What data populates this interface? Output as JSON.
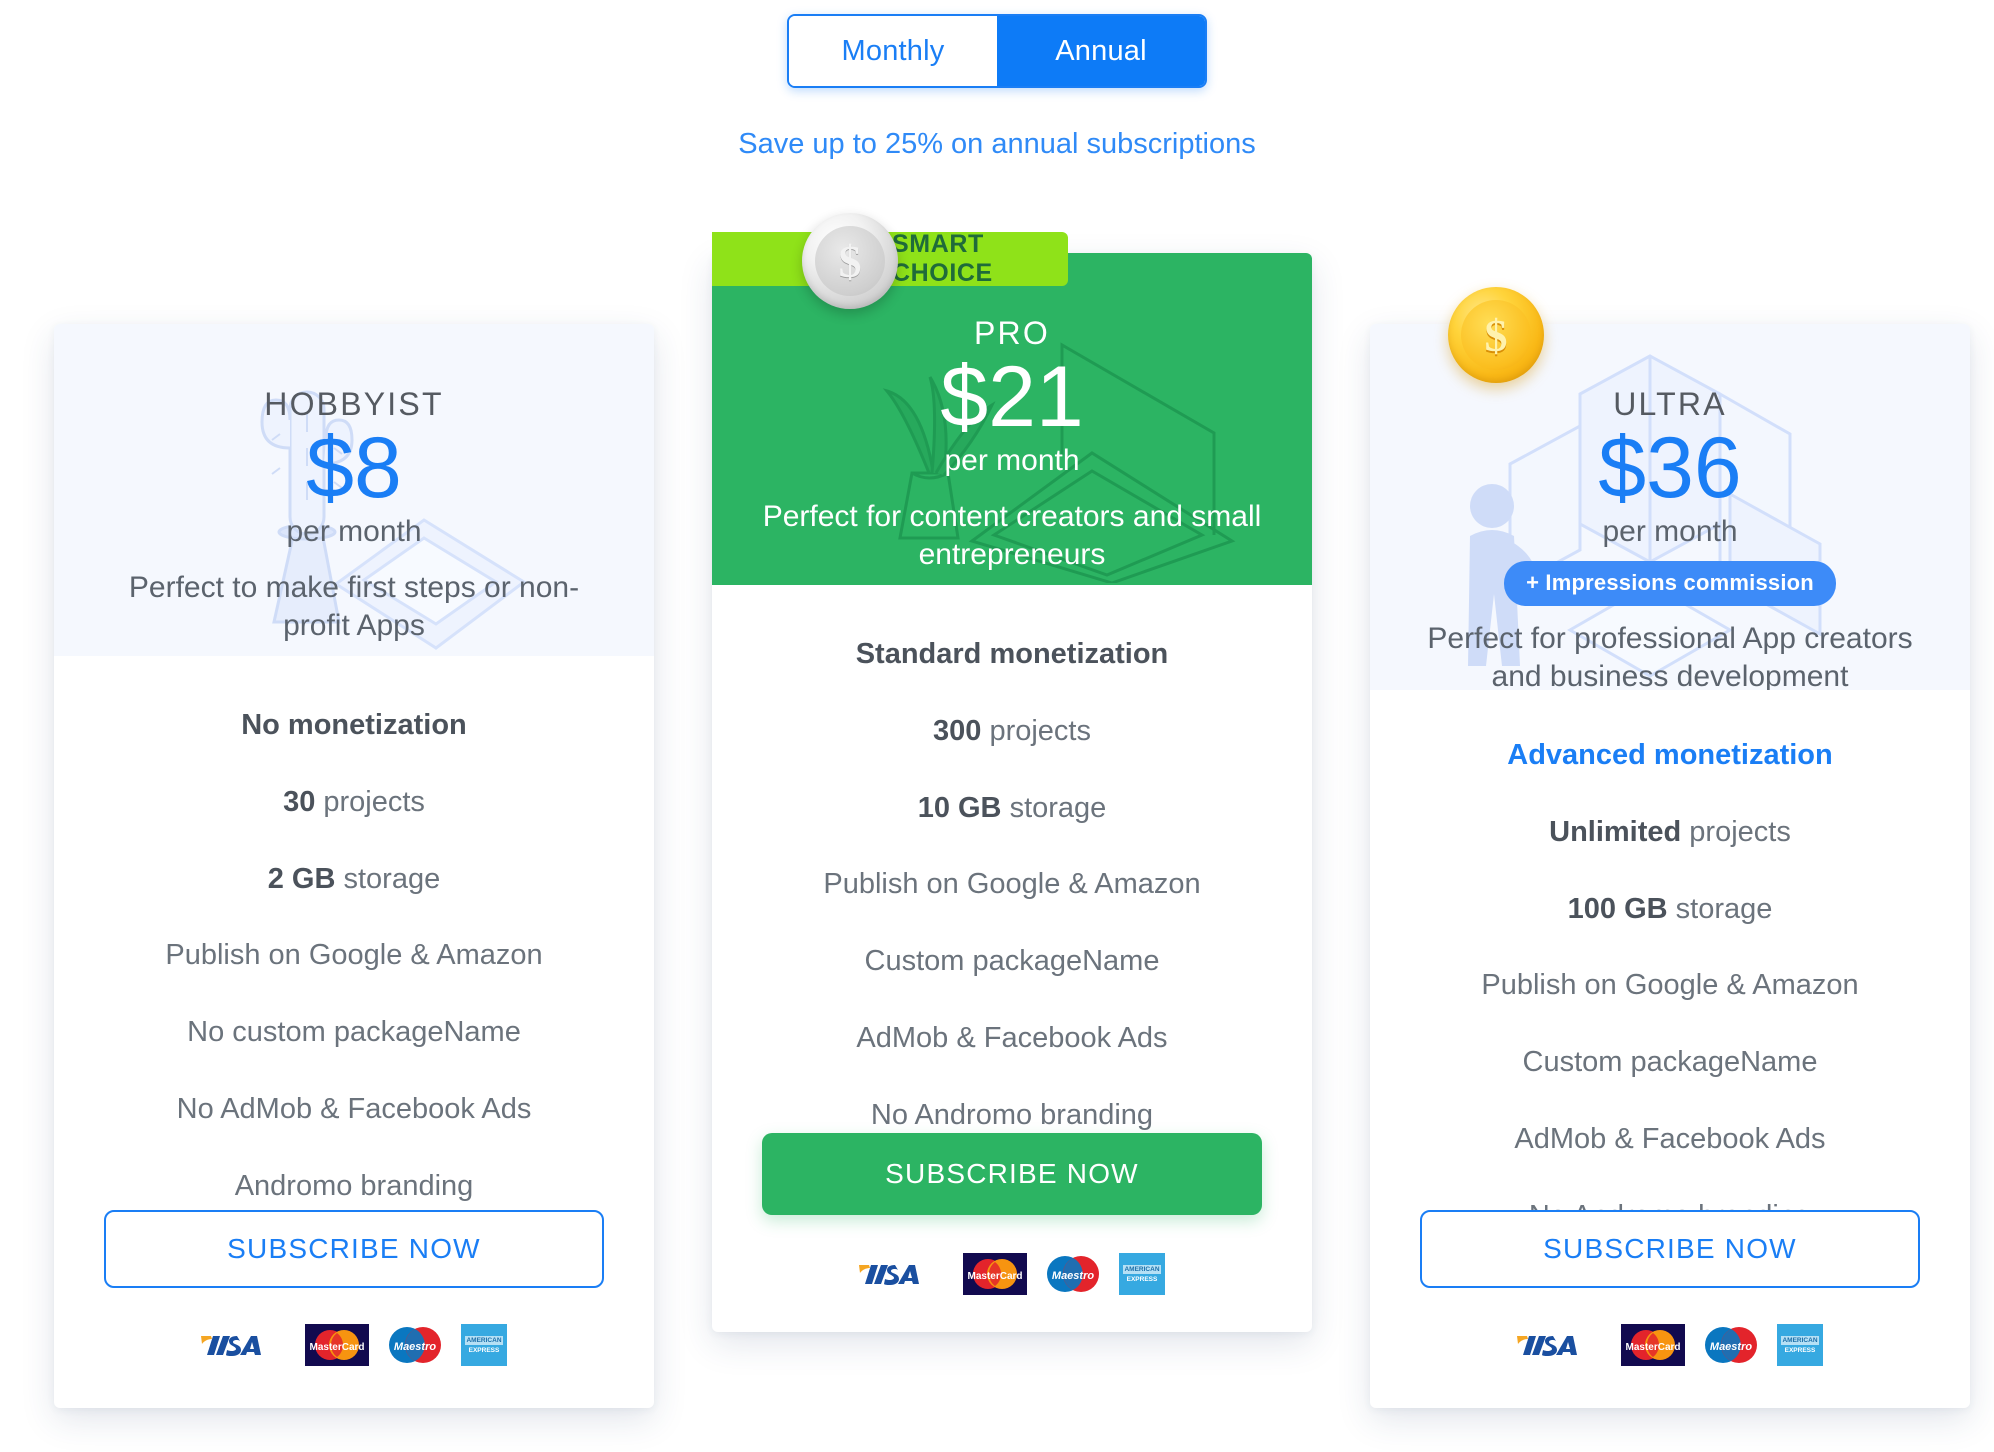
{
  "billing_toggle": {
    "options": [
      "Monthly",
      "Annual"
    ],
    "selected": "Annual",
    "monthly_label": "Monthly",
    "annual_label": "Annual"
  },
  "save_note": "Save up to 25% on annual subscriptions",
  "colors": {
    "accent_blue": "#1a7ef5",
    "toggle_active_blue": "#0d7bf7",
    "pro_green": "#2cb463",
    "badge_lime": "#8fe219",
    "badge_lime_text": "#1f6b3a",
    "header_tint": "#f5f8fe",
    "body_text": "#6b737c",
    "bold_text": "#4b525b",
    "gold_coin": "#f9b816",
    "silver_coin": "#d6d6d6"
  },
  "payment_methods": [
    {
      "name": "visa",
      "label": "VISA"
    },
    {
      "name": "mastercard",
      "label": "MasterCard"
    },
    {
      "name": "maestro",
      "label": "Maestro"
    },
    {
      "name": "amex",
      "label": "AMERICAN EXPRESS"
    }
  ],
  "plans": [
    {
      "id": "hobbyist",
      "name": "HOBBYIST",
      "price": "$8",
      "period": "per month",
      "tagline": "Perfect to make first steps or non-profit Apps",
      "badge": null,
      "illustration": "cactus-and-phone",
      "features": [
        {
          "bold": "No monetization",
          "rest": "",
          "accent": false
        },
        {
          "bold": "30",
          "rest": " projects",
          "accent": false
        },
        {
          "bold": "2 GB",
          "rest": " storage",
          "accent": false
        },
        {
          "bold": "",
          "rest": "Publish on Google & Amazon",
          "accent": false
        },
        {
          "bold": "",
          "rest": "No custom packageName",
          "accent": false
        },
        {
          "bold": "",
          "rest": "No AdMob & Facebook Ads",
          "accent": false
        },
        {
          "bold": "",
          "rest": "Andromo branding",
          "accent": false
        }
      ],
      "cta": "SUBSCRIBE NOW",
      "cta_style": "outline"
    },
    {
      "id": "pro",
      "name": "PRO",
      "price": "$21",
      "period": "per month",
      "tagline": "Perfect for content creators and small entrepreneurs",
      "badge": "SMART CHOICE",
      "coin": "silver-coin",
      "illustration": "plant-and-laptop",
      "features": [
        {
          "bold": "Standard monetization",
          "rest": "",
          "accent": false
        },
        {
          "bold": "300",
          "rest": " projects",
          "accent": false
        },
        {
          "bold": "10 GB",
          "rest": " storage",
          "accent": false
        },
        {
          "bold": "",
          "rest": "Publish on Google & Amazon",
          "accent": false
        },
        {
          "bold": "",
          "rest": "Custom packageName",
          "accent": false
        },
        {
          "bold": "",
          "rest": "AdMob & Facebook Ads",
          "accent": false
        },
        {
          "bold": "",
          "rest": "No Andromo branding",
          "accent": false
        }
      ],
      "cta": "SUBSCRIBE NOW",
      "cta_style": "solid"
    },
    {
      "id": "ultra",
      "name": "ULTRA",
      "price": "$36",
      "period": "per month",
      "tagline": "Perfect for professional App creators and business development",
      "badge": "+ Impressions commission",
      "coin": "gold-coin",
      "illustration": "person-and-buildings",
      "features": [
        {
          "bold": "Advanced monetization",
          "rest": "",
          "accent": true
        },
        {
          "bold": "Unlimited",
          "rest": " projects",
          "accent": false
        },
        {
          "bold": "100 GB",
          "rest": " storage",
          "accent": false
        },
        {
          "bold": "",
          "rest": "Publish on Google & Amazon",
          "accent": false
        },
        {
          "bold": "",
          "rest": "Custom packageName",
          "accent": false
        },
        {
          "bold": "",
          "rest": "AdMob & Facebook Ads",
          "accent": false
        },
        {
          "bold": "",
          "rest": "No Andromo branding",
          "accent": false
        }
      ],
      "cta": "SUBSCRIBE NOW",
      "cta_style": "outline"
    }
  ]
}
